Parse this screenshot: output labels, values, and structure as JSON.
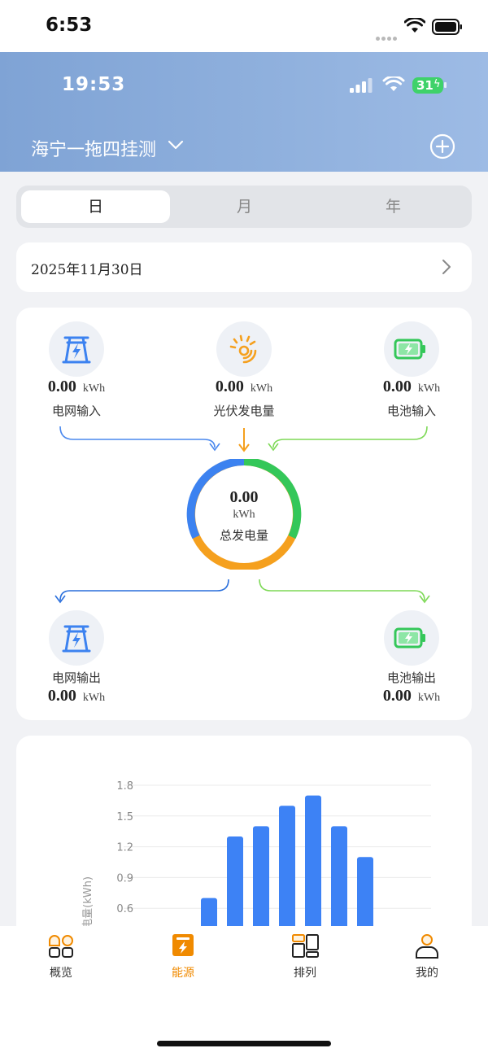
{
  "status_bar": {
    "time": "6:53"
  },
  "inner_status_bar": {
    "time": "19:53",
    "battery": "31"
  },
  "header": {
    "station_name": "海宁一拖四挂测"
  },
  "period_tabs": [
    {
      "label": "日",
      "selected": true
    },
    {
      "label": "月",
      "selected": false
    },
    {
      "label": "年",
      "selected": false
    }
  ],
  "date_selector": {
    "date": "2025年11月30日"
  },
  "energy_flow": {
    "grid_input": {
      "value": "0.00",
      "unit": "kWh",
      "label": "电网输入"
    },
    "pv_generation": {
      "value": "0.00",
      "unit": "kWh",
      "label": "光伏发电量"
    },
    "battery_input": {
      "value": "0.00",
      "unit": "kWh",
      "label": "电池输入"
    },
    "total": {
      "value": "0.00",
      "unit": "kWh",
      "label": "总发电量"
    },
    "grid_output": {
      "value": "0.00",
      "unit": "kWh",
      "label": "电网输出"
    },
    "battery_output": {
      "value": "0.00",
      "unit": "kWh",
      "label": "电池输出"
    },
    "colors": {
      "grid": "#3c82f0",
      "pv": "#f5a01e",
      "battery": "#34c759"
    }
  },
  "chart_data": {
    "type": "bar",
    "ylabel": "发电量(kWh)",
    "yticks": [
      "1.8",
      "1.5",
      "1.2",
      "0.9",
      "0.6"
    ],
    "ylim": [
      0,
      1.8
    ],
    "grid": true,
    "values": [
      0.7,
      1.3,
      1.4,
      1.6,
      1.7,
      1.4,
      1.1
    ],
    "bar_color": "#3d82f5"
  },
  "tabbar": {
    "items": [
      {
        "label": "概览",
        "icon": "overview-icon"
      },
      {
        "label": "能源",
        "icon": "energy-icon",
        "active": true
      },
      {
        "label": "排列",
        "icon": "arrangement-icon"
      },
      {
        "label": "我的",
        "icon": "profile-icon"
      }
    ],
    "active_color": "#f08a00"
  }
}
